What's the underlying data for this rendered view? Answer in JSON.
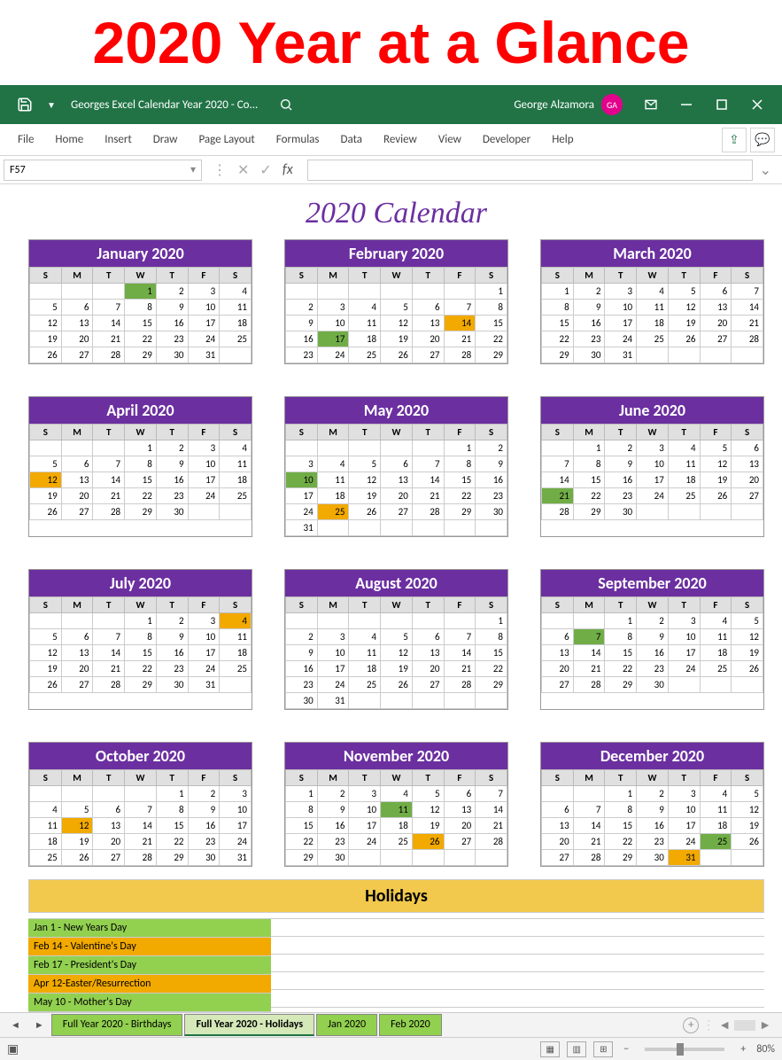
{
  "banner": "2020 Year at a Glance",
  "titlebar": {
    "doc": "Georges Excel Calendar Year 2020 - Co...",
    "user": "George Alzamora",
    "initials": "GA"
  },
  "ribbon": [
    "File",
    "Home",
    "Insert",
    "Draw",
    "Page Layout",
    "Formulas",
    "Data",
    "Review",
    "View",
    "Developer",
    "Help"
  ],
  "namebox": "F57",
  "fx_label": "fx",
  "calendar_title": "2020 Calendar",
  "dow": [
    "S",
    "M",
    "T",
    "W",
    "T",
    "F",
    "S"
  ],
  "months": [
    {
      "name": "January 2020",
      "start": 3,
      "days": 31,
      "green": [
        1
      ],
      "orange": []
    },
    {
      "name": "February 2020",
      "start": 6,
      "days": 29,
      "green": [
        17
      ],
      "orange": [
        14
      ]
    },
    {
      "name": "March 2020",
      "start": 0,
      "days": 31,
      "green": [],
      "orange": []
    },
    {
      "name": "April 2020",
      "start": 3,
      "days": 30,
      "green": [],
      "orange": [
        12
      ]
    },
    {
      "name": "May 2020",
      "start": 5,
      "days": 31,
      "green": [
        10
      ],
      "orange": [
        25
      ]
    },
    {
      "name": "June 2020",
      "start": 1,
      "days": 30,
      "green": [
        21
      ],
      "orange": []
    },
    {
      "name": "July 2020",
      "start": 3,
      "days": 31,
      "green": [],
      "orange": [
        4
      ]
    },
    {
      "name": "August 2020",
      "start": 6,
      "days": 31,
      "green": [],
      "orange": []
    },
    {
      "name": "September 2020",
      "start": 2,
      "days": 30,
      "green": [
        7
      ],
      "orange": []
    },
    {
      "name": "October 2020",
      "start": 4,
      "days": 31,
      "green": [],
      "orange": [
        12
      ]
    },
    {
      "name": "November 2020",
      "start": 0,
      "days": 30,
      "green": [
        11
      ],
      "orange": [
        26
      ]
    },
    {
      "name": "December 2020",
      "start": 2,
      "days": 31,
      "green": [
        25
      ],
      "orange": [
        31
      ]
    }
  ],
  "holidays_header": "Holidays",
  "holidays": [
    {
      "text": "Jan 1 - New Years Day",
      "cls": "g"
    },
    {
      "text": "Feb 14 - Valentine's Day",
      "cls": "o"
    },
    {
      "text": "Feb 17 - President's Day",
      "cls": "g"
    },
    {
      "text": "Apr 12-Easter/Resurrection",
      "cls": "o"
    },
    {
      "text": "May 10 - Mother's Day",
      "cls": "g"
    }
  ],
  "tabs": [
    {
      "label": "Full Year 2020 - Birthdays",
      "active": false
    },
    {
      "label": "Full Year 2020 - Holidays",
      "active": true
    },
    {
      "label": "Jan 2020",
      "active": false
    },
    {
      "label": "Feb 2020",
      "active": false
    }
  ],
  "zoom": "80%"
}
